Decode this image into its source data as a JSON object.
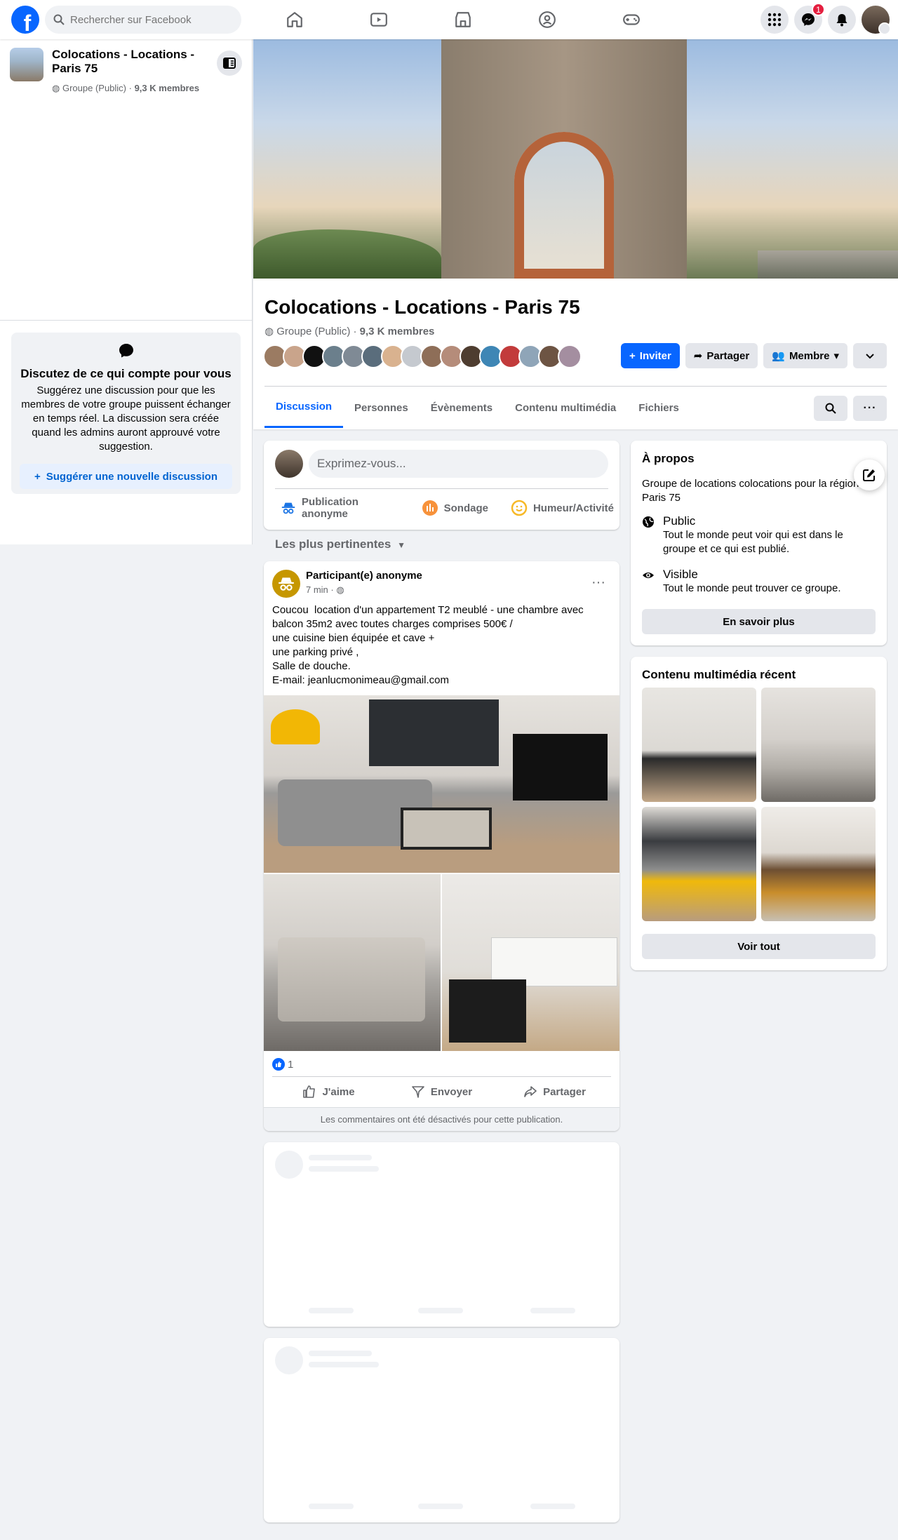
{
  "topbar": {
    "logo": "f",
    "search_placeholder": "Rechercher sur Facebook",
    "nav": [
      "home-icon",
      "video-icon",
      "marketplace-icon",
      "groups-icon",
      "gaming-icon"
    ],
    "messenger_badge": "1"
  },
  "sidebar": {
    "group_name": "Colocations - Locations - Paris 75",
    "group_privacy": "Groupe (Public)",
    "group_members": "9,3 K membres",
    "card_title": "Discutez de ce qui compte pour vous",
    "card_text": "Suggérez une discussion pour que les membres de votre groupe puissent échanger en temps réel. La discussion sera créée quand les admins auront approuvé votre suggestion.",
    "card_button": "Suggérer une nouvelle discussion"
  },
  "group": {
    "title": "Colocations - Locations - Paris 75",
    "privacy": "Groupe (Public)",
    "members": "9,3 K membres",
    "invite": "Inviter",
    "share": "Partager",
    "member": "Membre",
    "tabs": [
      "Discussion",
      "Personnes",
      "Évènements",
      "Contenu multimédia",
      "Fichiers"
    ],
    "member_colors": [
      "#9b7b62",
      "#c9a48b",
      "#111111",
      "#6b7f8c",
      "#7f8a95",
      "#5a6d7c",
      "#d9b28f",
      "#c5c9cf",
      "#8e6e58",
      "#b58c7a",
      "#4e3d30",
      "#3e86b5",
      "#c23b3b",
      "#8fa5b8",
      "#6d5443",
      "#a48ea0"
    ]
  },
  "composer": {
    "placeholder": "Exprimez-vous...",
    "actions": [
      "Publication anonyme",
      "Sondage",
      "Humeur/Activité"
    ]
  },
  "sort_label": "Les plus pertinentes",
  "post": {
    "author": "Participant(e) anonyme",
    "time": "7 min ·",
    "text_lines": [
      "Coucou  location d'un appartement T2 meublé - une chambre avec",
      "balcon 35m2 avec toutes charges comprises 500€ /",
      "une cuisine bien équipée et cave +",
      "une parking privé ,",
      "Salle de douche.",
      "E-mail: jeanlucmonimeau@gmail.com"
    ],
    "likes": "1",
    "actions": [
      "J'aime",
      "Envoyer",
      "Partager"
    ],
    "footer": "Les commentaires ont été désactivés pour cette publication."
  },
  "about": {
    "title": "À propos",
    "description": "Groupe de locations colocations pour la région Paris 75",
    "public_title": "Public",
    "public_desc": "Tout le monde peut voir qui est dans le groupe et ce qui est publié.",
    "visible_title": "Visible",
    "visible_desc": "Tout le monde peut trouver ce groupe.",
    "button": "En savoir plus"
  },
  "media": {
    "title": "Contenu multimédia récent",
    "button": "Voir tout"
  },
  "colors": {
    "brand": "#0866ff",
    "badge": "#e41e3f",
    "anonymous": "#c69700"
  }
}
